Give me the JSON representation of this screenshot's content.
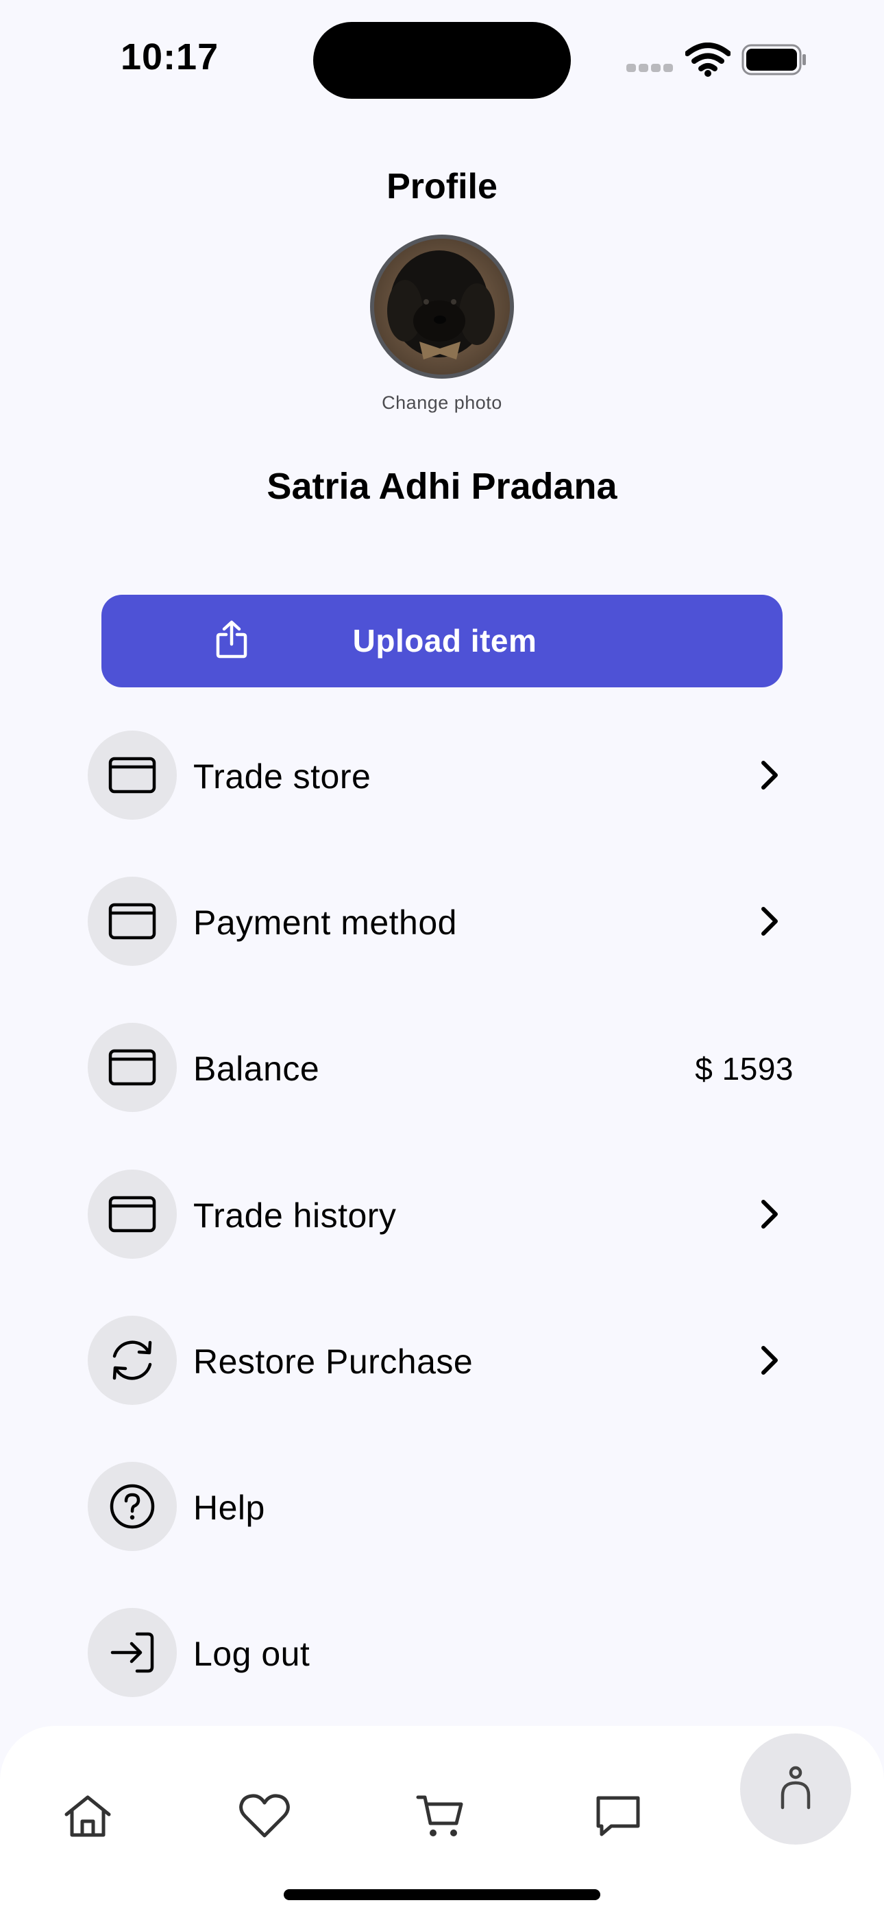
{
  "status_bar": {
    "time": "10:17",
    "icons": [
      "cellular-signal-icon",
      "wifi-icon",
      "battery-icon"
    ]
  },
  "header": {
    "title": "Profile",
    "change_photo_label": "Change photo",
    "user_name": "Satria Adhi Pradana"
  },
  "upload_button": {
    "label": "Upload item",
    "icon": "share-upload-icon",
    "color": "#4e52d6"
  },
  "menu": {
    "items": [
      {
        "label": "Trade store",
        "icon": "card-icon",
        "trailing": "chevron"
      },
      {
        "label": "Payment method",
        "icon": "card-icon",
        "trailing": "chevron"
      },
      {
        "label": "Balance",
        "icon": "card-icon",
        "trailing": "value",
        "value": "$ 1593"
      },
      {
        "label": "Trade history",
        "icon": "card-icon",
        "trailing": "chevron"
      },
      {
        "label": "Restore Purchase",
        "icon": "refresh-icon",
        "trailing": "chevron"
      },
      {
        "label": "Help",
        "icon": "help-circle-icon"
      },
      {
        "label": "Log out",
        "icon": "log-in-icon"
      }
    ]
  },
  "bottom_nav": {
    "items": [
      "home-icon",
      "heart-icon",
      "cart-icon",
      "message-icon",
      "profile-icon"
    ],
    "active": "profile-icon"
  },
  "colors": {
    "background": "#f8f8fe",
    "accent": "#4e52d6",
    "icon_circle": "#e6e6ea"
  }
}
